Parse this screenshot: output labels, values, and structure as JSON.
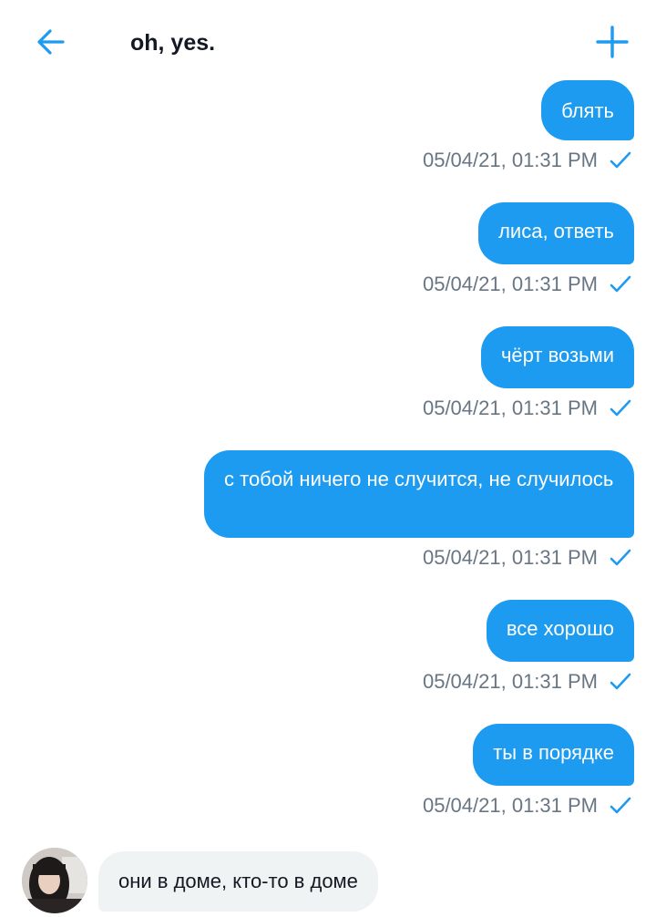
{
  "header": {
    "title": "oh, yes."
  },
  "colors": {
    "accent": "#1d9bf0",
    "meta_text": "#687684",
    "incoming_bubble": "#eff3f4"
  },
  "icons": {
    "back": "arrow-left-icon",
    "add": "plus-icon",
    "read_status": "checkmark-icon"
  },
  "messages": [
    {
      "text": "блять",
      "time": "05/04/21, 01:31 PM"
    },
    {
      "text": "лиса, ответь",
      "time": "05/04/21, 01:31 PM"
    },
    {
      "text": "чёрт возьми",
      "time": "05/04/21, 01:31 PM"
    },
    {
      "text": "с тобой ничего не случится, не случилось",
      "time": "05/04/21, 01:31 PM"
    },
    {
      "text": "все хорошо",
      "time": "05/04/21, 01:31 PM"
    },
    {
      "text": "ты в порядке",
      "time": "05/04/21, 01:31 PM"
    }
  ],
  "incoming": {
    "text": "они в доме, кто-то в доме"
  }
}
